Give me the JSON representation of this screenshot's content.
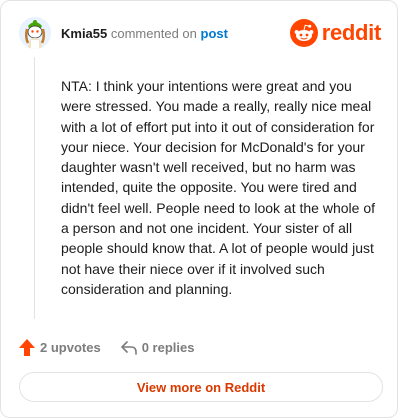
{
  "header": {
    "username": "Kmia55",
    "commented_text": "commented on",
    "post_link": "post",
    "brand": "reddit",
    "avatar_icon": "snoo-avatar-icon",
    "logo_icon": "reddit-logo-icon"
  },
  "comment": {
    "body": "NTA: I think your intentions were great and you were stressed. You made a really, really nice meal with a lot of effort put into it out of consideration for your niece. Your decision for McDonald's for your daughter wasn't well received, but no harm was intended, quite the opposite. You were tired and didn't feel well. People need to look at the whole of a person and not one incident. Your sister of all people should know that. A lot of people would just not have their niece over if it involved such consideration and planning."
  },
  "actions": {
    "upvotes_label": "2 upvotes",
    "replies_label": "0 replies",
    "upvote_icon": "upvote-arrow-icon",
    "reply_icon": "reply-arrow-icon"
  },
  "footer": {
    "view_more_label": "View more on Reddit"
  },
  "colors": {
    "brand_orange": "#ff4500",
    "link_blue": "#0079d3",
    "muted_text": "#7c7c7c",
    "view_more_text": "#d93a00"
  }
}
